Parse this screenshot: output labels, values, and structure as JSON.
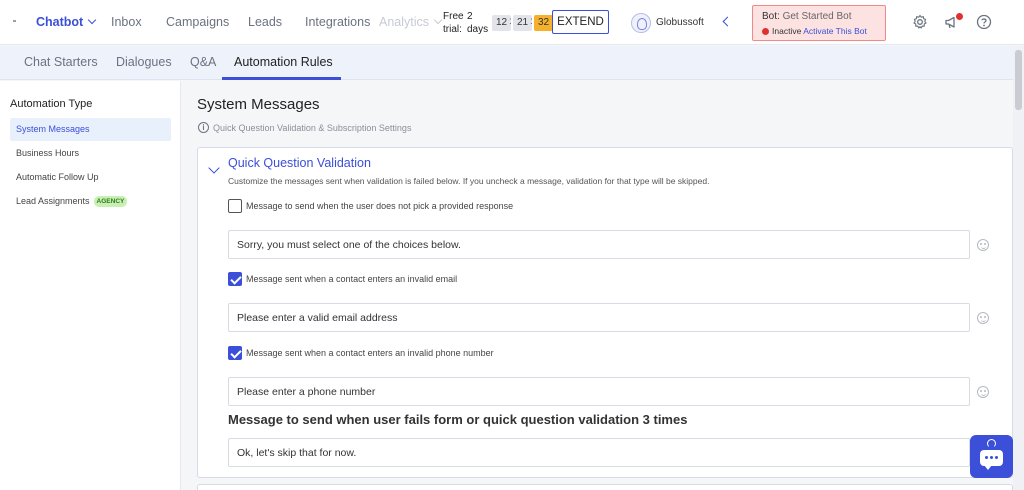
{
  "nav": {
    "items": [
      {
        "label": "Chatbot"
      },
      {
        "label": "Inbox"
      },
      {
        "label": "Campaigns"
      },
      {
        "label": "Leads"
      },
      {
        "label": "Integrations"
      },
      {
        "label": "Analytics"
      }
    ],
    "trial": {
      "free": "Free",
      "count": "2",
      "trial": "trial:",
      "days": "days"
    },
    "timer": {
      "hours": "12",
      "minutes": "21",
      "seconds": "32",
      "sep": ":"
    },
    "extend_label": "EXTEND",
    "profile_name": "Globussoft",
    "bot": {
      "prefix": "Bot:",
      "name": "Get Started Bot",
      "status": "Inactive",
      "activate_link": "Activate This Bot"
    }
  },
  "subtabs": [
    {
      "label": "Chat Starters"
    },
    {
      "label": "Dialogues"
    },
    {
      "label": "Q&A"
    },
    {
      "label": "Automation Rules"
    }
  ],
  "sidebar": {
    "heading": "Automation Type",
    "items": [
      {
        "label": "System Messages"
      },
      {
        "label": "Business Hours"
      },
      {
        "label": "Automatic Follow Up"
      },
      {
        "label": "Lead Assignments",
        "badge": "AGENCY"
      }
    ]
  },
  "main": {
    "title": "System Messages",
    "subtitle": "Quick Question Validation & Subscription Settings",
    "card": {
      "title": "Quick Question Validation",
      "description": "Customize the messages sent when validation is failed below. If you uncheck a message, validation for that type will be skipped.",
      "rows": [
        {
          "label": "Message to send when the user does not pick a provided response",
          "checked": false,
          "value": "Sorry, you must select one of the choices below."
        },
        {
          "label": "Message sent when a contact enters an invalid email",
          "checked": true,
          "value": "Please enter a valid email address"
        },
        {
          "label": "Message sent when a contact enters an invalid phone number",
          "checked": true,
          "value": "Please enter a phone number"
        }
      ],
      "fail_heading": "Message to send when user fails form or quick question validation 3 times",
      "fail_value": "Ok, let's skip that for now."
    }
  },
  "colors": {
    "accent": "#3b4fd8",
    "inactive_red": "#e03131",
    "timer_highlight": "#f5b12c"
  }
}
